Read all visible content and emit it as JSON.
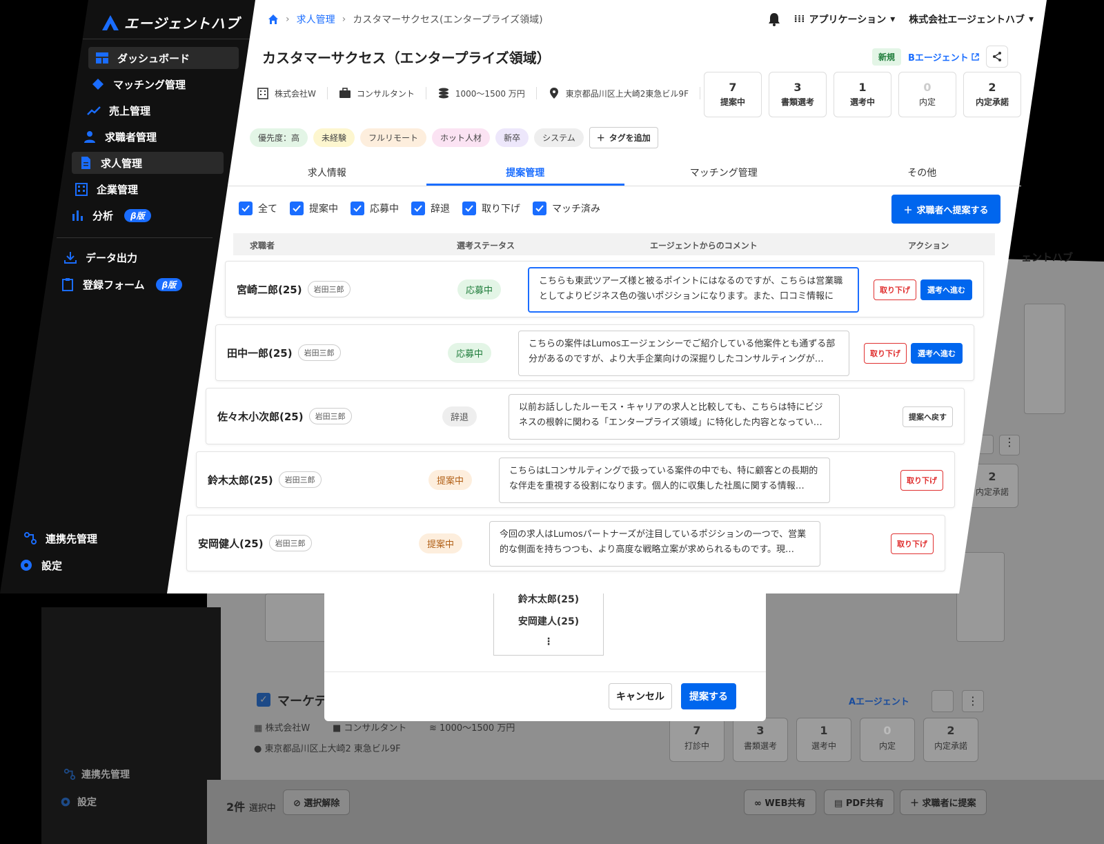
{
  "app": {
    "logo_text": "エージェントハブ",
    "accent_color": "#0066ee"
  },
  "sidebar": {
    "items": [
      {
        "label": "ダッシュボード",
        "icon": "dashboard-icon"
      },
      {
        "label": "マッチング管理",
        "icon": "diamond-icon"
      },
      {
        "label": "売上管理",
        "icon": "trend-icon"
      },
      {
        "label": "求職者管理",
        "icon": "person-icon"
      },
      {
        "label": "求人管理",
        "icon": "document-icon"
      },
      {
        "label": "企業管理",
        "icon": "building-icon"
      },
      {
        "label": "分析",
        "icon": "bar-chart-icon",
        "badge": "β版"
      },
      {
        "label": "データ出力",
        "icon": "download-icon"
      },
      {
        "label": "登録フォーム",
        "icon": "clipboard-icon",
        "badge": "β版"
      },
      {
        "label": "連携先管理",
        "icon": "link-icon"
      },
      {
        "label": "設定",
        "icon": "gear-icon"
      }
    ]
  },
  "breadcrumb": {
    "section": "求人管理",
    "current": "カスタマーサクセス(エンタープライズ領域)"
  },
  "header": {
    "apps_label": "アプリケーション",
    "company_label": "株式会社エージェントハブ"
  },
  "job": {
    "title": "カスタマーサクセス（エンタープライズ領域）",
    "badge": "新規",
    "agent": "Bエージェント",
    "company": "株式会社W",
    "category": "コンサルタント",
    "salary": "1000〜1500 万円",
    "location": "東京都品川区上大崎2東急ビル9F"
  },
  "stats": [
    {
      "value": "7",
      "label": "提案中"
    },
    {
      "value": "3",
      "label": "書類選考"
    },
    {
      "value": "1",
      "label": "選考中"
    },
    {
      "value": "0",
      "label": "内定"
    },
    {
      "value": "2",
      "label": "内定承諾"
    }
  ],
  "tags": [
    {
      "label": "優先度：高",
      "color": "#e3f5e6"
    },
    {
      "label": "未経験",
      "color": "#fdf6cf"
    },
    {
      "label": "フルリモート",
      "color": "#fdeedd"
    },
    {
      "label": "ホット人材",
      "color": "#fbe3f3"
    },
    {
      "label": "新卒",
      "color": "#ede7fb"
    },
    {
      "label": "システム",
      "color": "#eeeeee"
    }
  ],
  "tag_add_label": "タグを追加",
  "tabs": [
    "求人情報",
    "提案管理",
    "マッチング管理",
    "その他"
  ],
  "filters": [
    "全て",
    "提案中",
    "応募中",
    "辞退",
    "取り下げ",
    "マッチ済み"
  ],
  "propose_button": "求職者へ提案する",
  "table": {
    "headers": [
      "求職者",
      "選考ステータス",
      "エージェントからのコメント",
      "アクション"
    ],
    "rows": [
      {
        "name": "宮崎二郎(25)",
        "owner": "岩田三郎",
        "status": "応募中",
        "comment": "こちらも東武ツアーズ様と被るポイントにはなるのですが、こちらは営業職としてよりビジネス色の強いポジションになります。また、口コミ情報に",
        "actions": [
          "取り下げ",
          "選考へ進む"
        ]
      },
      {
        "name": "田中一郎(25)",
        "owner": "岩田三郎",
        "status": "応募中",
        "comment": "こちらの案件はLumosエージェンシーでご紹介している他案件とも通ずる部分があるのですが、より大手企業向けの深掘りしたコンサルティングが…",
        "actions": [
          "取り下げ",
          "選考へ進む"
        ]
      },
      {
        "name": "佐々木小次郎(25)",
        "owner": "岩田三郎",
        "status": "辞退",
        "comment": "以前お話ししたルーモス・キャリアの求人と比較しても、こちらは特にビジネスの根幹に関わる「エンタープライズ領域」に特化した内容となってい…",
        "actions": [
          "提案へ戻す"
        ]
      },
      {
        "name": "鈴木太郎(25)",
        "owner": "岩田三郎",
        "status": "提案中",
        "comment": "こちらはLコンサルティングで扱っている案件の中でも、特に顧客との長期的な伴走を重視する役割になります。個人的に収集した社風に関する情報…",
        "actions": [
          "取り下げ"
        ]
      },
      {
        "name": "安岡健人(25)",
        "owner": "岩田三郎",
        "status": "提案中",
        "comment": "今回の求人はLumosパートナーズが注目しているポジションの一つで、営業的な側面を持ちつつも、より高度な戦略立案が求められるものです。現…",
        "actions": [
          "取り下げ"
        ]
      }
    ]
  },
  "modal": {
    "list": [
      "鈴木太郎(25)",
      "安岡建人(25)"
    ],
    "more": "⋮",
    "cancel": "キャンセル",
    "submit": "提案する"
  },
  "background": {
    "company_fragment": "ェントハブ",
    "card_title": "マーケテ",
    "agent": "Aエージェント",
    "company": "株式会社W",
    "category": "コンサルタント",
    "salary": "1000〜1500 万円",
    "location": "東京都品川区上大崎2 東急ビル9F",
    "stats": [
      {
        "value": "7",
        "label": "打診中"
      },
      {
        "value": "3",
        "label": "書類選考"
      },
      {
        "value": "1",
        "label": "選考中"
      },
      {
        "value": "0",
        "label": "内定"
      },
      {
        "value": "2",
        "label": "内定承諾"
      }
    ],
    "side_stat": {
      "value": "2",
      "label": "内定承諾"
    },
    "selected_count": "2件",
    "selected_suffix": "選択中",
    "clear_selection": "選択解除",
    "web_share": "WEB共有",
    "pdf_share": "PDF共有",
    "propose": "求職者に提案",
    "side_items": [
      "連携先管理",
      "設定"
    ]
  }
}
